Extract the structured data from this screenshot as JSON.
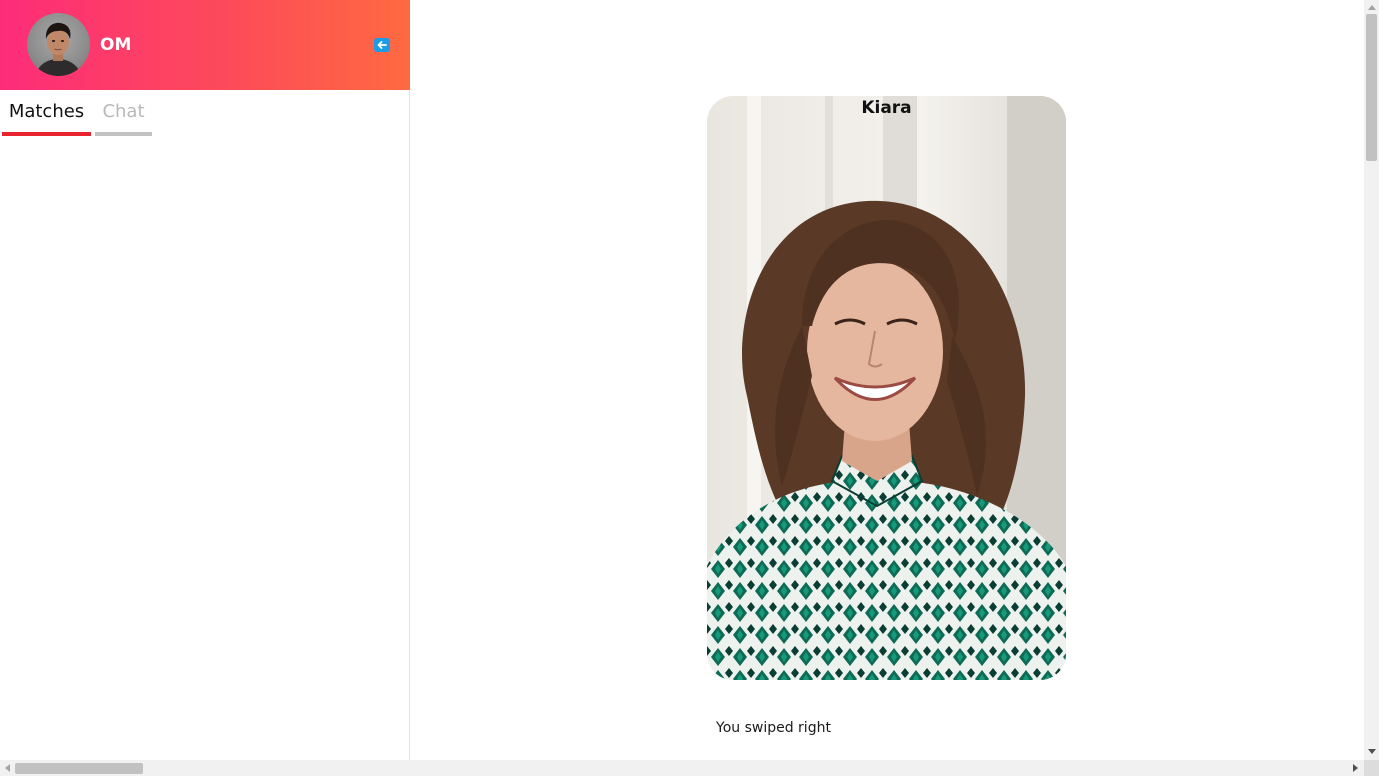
{
  "user": {
    "name": "OM"
  },
  "tabs": [
    {
      "label": "Matches",
      "active": true
    },
    {
      "label": "Chat",
      "active": false
    }
  ],
  "card": {
    "name": "Kiara"
  },
  "swipe_status": "You swiped right",
  "colors": {
    "header_gradient_start": "#fd2c79",
    "header_gradient_end": "#fe6a40",
    "active_tab_underline": "#e8252f",
    "logout_button": "#1e9be6"
  }
}
